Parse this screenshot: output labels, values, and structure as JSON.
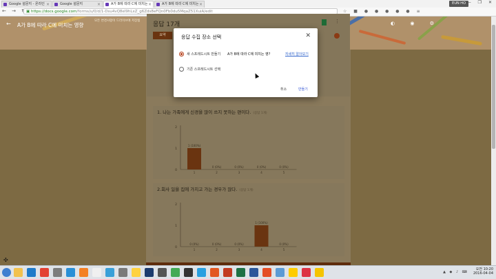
{
  "browser": {
    "tabs": [
      {
        "label": "Google 설문지 - 온라인",
        "active": false
      },
      {
        "label": "Google 설문지",
        "active": false
      },
      {
        "label": "A가 B에 따라 C에 미치는",
        "active": true
      },
      {
        "label": "A가 B에 따라 C에 미치는",
        "active": false
      }
    ],
    "user_chip": "EUN HO",
    "window_controls": "— ❐ ✕",
    "nav_glyphs": "← → ↻",
    "url_host": "https://docs.google.com",
    "url_path": "/forms/u/0/d/1-Dsu4vQ8eI9hLxZ_g6Zds8eFQn0Fb0du5MqaZ51XuiA/edit",
    "extension_glyphs": "☆ ■ ● ● ● ● ● ≡"
  },
  "form": {
    "back_glyph": "←",
    "title": "A가 B에 따라 C에 미치는 영향",
    "subtitle": "모든 변경사항이 드라이브에 저장됨",
    "header_glyphs": "◐ ◉ ⚙",
    "theme_color": "#b0916a"
  },
  "responses": {
    "title": "응답 17개",
    "summary_tab": "요약",
    "more_glyph": "⋮"
  },
  "questions": [
    {
      "title": "1. 나는 가족에게 신경을 많이 쓰지 못하는 편이다.",
      "count": "(응답 1개)",
      "chart_data": {
        "type": "bar",
        "categories": [
          "1",
          "2",
          "3",
          "4",
          "5"
        ],
        "values": [
          1,
          0,
          0,
          0,
          0
        ],
        "labels": [
          "1 (100%)",
          "0 (0%)",
          "0 (0%)",
          "0 (0%)",
          "0 (0%)"
        ],
        "y_ticks": [
          "0",
          "1",
          "2"
        ],
        "ylim": [
          0,
          2
        ]
      }
    },
    {
      "title": "2.회사 일을 집에 가지고 가는 경우가 많다.",
      "count": "(응답 1개)",
      "chart_data": {
        "type": "bar",
        "categories": [
          "1",
          "2",
          "3",
          "4",
          "5"
        ],
        "values": [
          0,
          0,
          0,
          1,
          0
        ],
        "labels": [
          "0 (0%)",
          "0 (0%)",
          "0 (0%)",
          "1 (100%)",
          "0 (0%)"
        ],
        "y_ticks": [
          "0",
          "1",
          "2"
        ],
        "ylim": [
          0,
          2
        ]
      }
    }
  ],
  "dialog": {
    "title": "응답 수집 장소 선택",
    "close_glyph": "✕",
    "option_new": "새 스프레드시트 만들기",
    "new_sheet_name": "A가 B에 따라 C에 미치는 영?",
    "learn_more": "자세히 알아보기",
    "option_existing": "기존 스프레드시트 선택",
    "cancel": "취소",
    "create": "만들기"
  },
  "taskbar": {
    "time": "오전 10:20",
    "date": "2016-04-04",
    "tray_glyphs": "▲ ◆ ♪ ⌨",
    "icon_colors": [
      "#f2c14e",
      "#1f7bc9",
      "#e34133",
      "#7d7d7d",
      "#2a8fd6",
      "#f48024",
      "#f0f0f0",
      "#3aa0d8",
      "#7a7a7a",
      "#ffd23f",
      "#1d3c6e",
      "#555555",
      "#44aa55",
      "#333333",
      "#2aa0e0",
      "#e25822",
      "#c23b22",
      "#1e7145",
      "#2b579a",
      "#e44d26",
      "#5c9bd5",
      "#ffcc00",
      "#dd3344",
      "#f5c400"
    ]
  }
}
